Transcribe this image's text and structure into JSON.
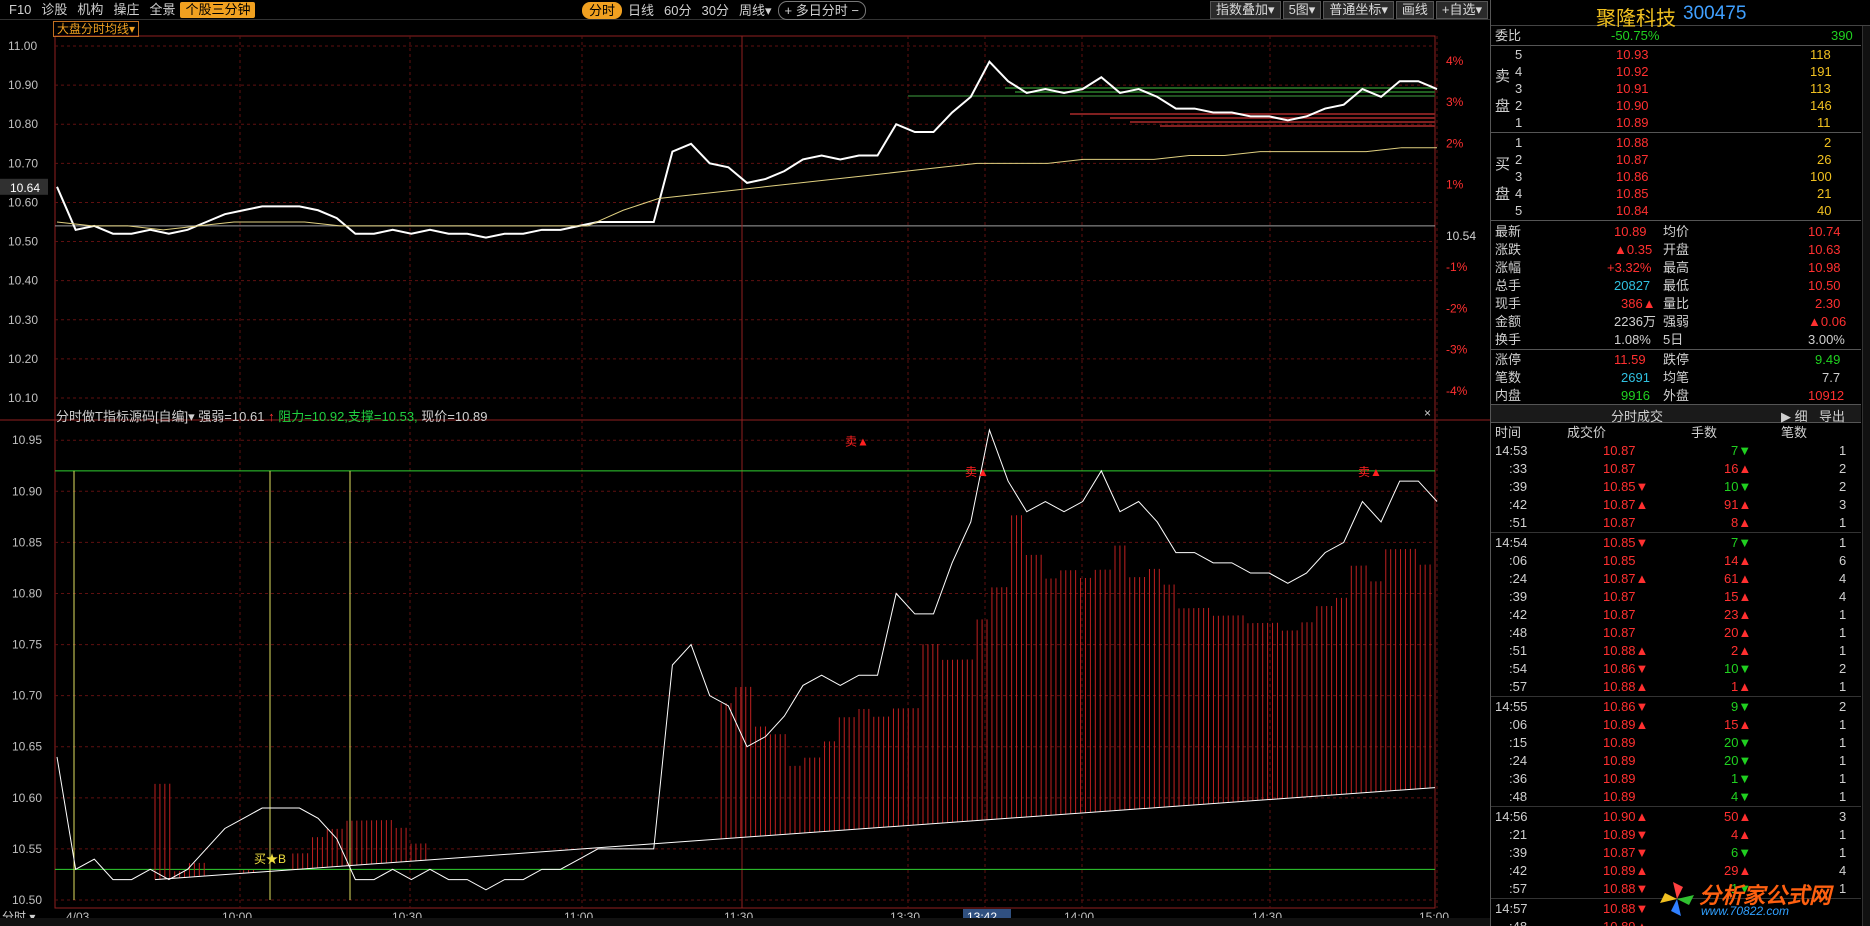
{
  "toolbar": {
    "left": [
      "F10",
      "诊股",
      "机构",
      "操庄",
      "全景",
      "个股三分钟"
    ],
    "left_active": 5,
    "center": [
      "分时",
      "日线",
      "60分",
      "30分",
      "周线▾",
      "+ 多日分时 −"
    ],
    "center_active": 0,
    "right": [
      "指数叠加▾",
      "5图▾",
      "普通坐标▾",
      "画线",
      "+自选▾"
    ]
  },
  "main_chart": {
    "indicator_tag": "大盘分时均线▾",
    "price_ticks": [
      "11.00",
      "10.90",
      "10.80",
      "10.70",
      "10.60",
      "10.50",
      "10.40",
      "10.30",
      "10.20",
      "10.10"
    ],
    "current_price_label": "10.64",
    "prev_close_label": "10.54",
    "pct_ticks": [
      "4%",
      "3%",
      "2%",
      "1%",
      "-1%",
      "-2%",
      "-3%",
      "-4%"
    ]
  },
  "sub_chart": {
    "title_a": "分时做T指标源码[自编]▾  强弱=10.61",
    "arrow": "↑",
    "title_b": "阻力=10.92,支撑=10.53,",
    "title_c": "现价=10.89",
    "close_icon": "×",
    "ticks": [
      "10.95",
      "10.90",
      "10.85",
      "10.80",
      "10.75",
      "10.70",
      "10.65",
      "10.60",
      "10.55",
      "10.50"
    ],
    "buy_label": "买★B",
    "sell_labels": [
      "卖▲",
      "卖▲",
      "卖▲"
    ]
  },
  "time_axis": {
    "labels": [
      "4/03",
      "10:00",
      "10:30",
      "11:00",
      "11:30",
      "13:30",
      "13:42",
      "14:00",
      "14:30",
      "15:00"
    ],
    "mode_label": "分时 ▾"
  },
  "quote": {
    "name": "聚隆科技",
    "code": "300475",
    "weibi_label": "委比",
    "weibi_value": "-50.75%",
    "weicha_value": "390",
    "sell_side_label": "卖盘",
    "buy_side_label": "买盘",
    "asks": [
      {
        "level": "5",
        "price": "10.93",
        "vol": "118"
      },
      {
        "level": "4",
        "price": "10.92",
        "vol": "191"
      },
      {
        "level": "3",
        "price": "10.91",
        "vol": "113"
      },
      {
        "level": "2",
        "price": "10.90",
        "vol": "146"
      },
      {
        "level": "1",
        "price": "10.89",
        "vol": "11"
      }
    ],
    "bids": [
      {
        "level": "1",
        "price": "10.88",
        "vol": "2"
      },
      {
        "level": "2",
        "price": "10.87",
        "vol": "26"
      },
      {
        "level": "3",
        "price": "10.86",
        "vol": "100"
      },
      {
        "level": "4",
        "price": "10.85",
        "vol": "21"
      },
      {
        "level": "5",
        "price": "10.84",
        "vol": "40"
      }
    ],
    "stats": [
      {
        "l1": "最新",
        "v1": "10.89",
        "c1": "red",
        "l2": "均价",
        "v2": "10.74",
        "c2": "red"
      },
      {
        "l1": "涨跌",
        "v1": "▲0.35",
        "c1": "red",
        "l2": "开盘",
        "v2": "10.63",
        "c2": "red"
      },
      {
        "l1": "涨幅",
        "v1": "+3.32%",
        "c1": "red",
        "l2": "最高",
        "v2": "10.98",
        "c2": "red"
      },
      {
        "l1": "总手",
        "v1": "20827",
        "c1": "cyn",
        "l2": "最低",
        "v2": "10.50",
        "c2": "red"
      },
      {
        "l1": "现手",
        "v1": "386▲",
        "c1": "red",
        "l2": "量比",
        "v2": "2.30",
        "c2": "red"
      },
      {
        "l1": "金额",
        "v1": "2236万",
        "c1": "wht",
        "l2": "强弱",
        "v2": "▲0.06",
        "c2": "red"
      },
      {
        "l1": "换手",
        "v1": "1.08%",
        "c1": "wht",
        "l2": "5日",
        "v2": "3.00%",
        "c2": "wht"
      },
      {
        "l1": "涨停",
        "v1": "11.59",
        "c1": "red",
        "l2": "跌停",
        "v2": "9.49",
        "c2": "grn"
      },
      {
        "l1": "笔数",
        "v1": "2691",
        "c1": "cyn",
        "l2": "均笔",
        "v2": "7.7",
        "c2": "wht"
      },
      {
        "l1": "内盘",
        "v1": "9916",
        "c1": "grn",
        "l2": "外盘",
        "v2": "10912",
        "c2": "red"
      }
    ]
  },
  "tape": {
    "title": "分时成交",
    "detail_label": "▶ 细",
    "export_label": "导出",
    "headers": [
      "时间",
      "成交价",
      "手数",
      "笔数"
    ],
    "rows": [
      {
        "t": "14:53",
        "p": "10.87",
        "pc": "red",
        "v": "7▼",
        "vc": "grn",
        "n": "1",
        "group": true
      },
      {
        "t": ":33",
        "p": "10.87",
        "pc": "red",
        "v": "16▲",
        "vc": "red",
        "n": "2"
      },
      {
        "t": ":39",
        "p": "10.85▼",
        "pc": "red",
        "v": "10▼",
        "vc": "grn",
        "n": "2"
      },
      {
        "t": ":42",
        "p": "10.87▲",
        "pc": "red",
        "v": "91▲",
        "vc": "red",
        "n": "3"
      },
      {
        "t": ":51",
        "p": "10.87",
        "pc": "red",
        "v": "8▲",
        "vc": "red",
        "n": "1"
      },
      {
        "t": "14:54",
        "p": "10.85▼",
        "pc": "red",
        "v": "7▼",
        "vc": "grn",
        "n": "1",
        "group": true
      },
      {
        "t": ":06",
        "p": "10.85",
        "pc": "red",
        "v": "14▲",
        "vc": "red",
        "n": "6"
      },
      {
        "t": ":24",
        "p": "10.87▲",
        "pc": "red",
        "v": "61▲",
        "vc": "red",
        "n": "4"
      },
      {
        "t": ":39",
        "p": "10.87",
        "pc": "red",
        "v": "15▲",
        "vc": "red",
        "n": "4"
      },
      {
        "t": ":42",
        "p": "10.87",
        "pc": "red",
        "v": "23▲",
        "vc": "red",
        "n": "1"
      },
      {
        "t": ":48",
        "p": "10.87",
        "pc": "red",
        "v": "20▲",
        "vc": "red",
        "n": "1"
      },
      {
        "t": ":51",
        "p": "10.88▲",
        "pc": "red",
        "v": "2▲",
        "vc": "red",
        "n": "1"
      },
      {
        "t": ":54",
        "p": "10.86▼",
        "pc": "red",
        "v": "10▼",
        "vc": "grn",
        "n": "2"
      },
      {
        "t": ":57",
        "p": "10.88▲",
        "pc": "red",
        "v": "1▲",
        "vc": "red",
        "n": "1"
      },
      {
        "t": "14:55",
        "p": "10.86▼",
        "pc": "red",
        "v": "9▼",
        "vc": "grn",
        "n": "2",
        "group": true
      },
      {
        "t": ":06",
        "p": "10.89▲",
        "pc": "red",
        "v": "15▲",
        "vc": "red",
        "n": "1"
      },
      {
        "t": ":15",
        "p": "10.89",
        "pc": "red",
        "v": "20▼",
        "vc": "grn",
        "n": "1"
      },
      {
        "t": ":24",
        "p": "10.89",
        "pc": "red",
        "v": "20▼",
        "vc": "grn",
        "n": "1"
      },
      {
        "t": ":36",
        "p": "10.89",
        "pc": "red",
        "v": "1▼",
        "vc": "grn",
        "n": "1"
      },
      {
        "t": ":48",
        "p": "10.89",
        "pc": "red",
        "v": "4▼",
        "vc": "grn",
        "n": "1"
      },
      {
        "t": "14:56",
        "p": "10.90▲",
        "pc": "red",
        "v": "50▲",
        "vc": "red",
        "n": "3",
        "group": true
      },
      {
        "t": ":21",
        "p": "10.89▼",
        "pc": "red",
        "v": "4▲",
        "vc": "red",
        "n": "1"
      },
      {
        "t": ":39",
        "p": "10.87▼",
        "pc": "red",
        "v": "6▼",
        "vc": "grn",
        "n": "1"
      },
      {
        "t": ":42",
        "p": "10.89▲",
        "pc": "red",
        "v": "29▲",
        "vc": "red",
        "n": "4"
      },
      {
        "t": ":57",
        "p": "10.88▼",
        "pc": "red",
        "v": "1▼",
        "vc": "grn",
        "n": "1"
      },
      {
        "t": "14:57",
        "p": "10.88▼",
        "pc": "red",
        "v": "",
        "vc": "grn",
        "n": "",
        "group": true
      },
      {
        "t": ":48",
        "p": "10.89▲",
        "pc": "red",
        "v": "",
        "vc": "red",
        "n": ""
      }
    ]
  },
  "watermark": {
    "text": "分析家公式网",
    "url": "www.70822.com"
  },
  "chart_data": {
    "type": "line",
    "x_range": [
      "09:30",
      "15:00"
    ],
    "price_ylim": [
      10.1,
      11.0
    ],
    "prev_close": 10.54,
    "price_series": [
      10.64,
      10.53,
      10.54,
      10.52,
      10.52,
      10.53,
      10.52,
      10.53,
      10.55,
      10.57,
      10.58,
      10.59,
      10.59,
      10.59,
      10.58,
      10.56,
      10.52,
      10.52,
      10.53,
      10.52,
      10.53,
      10.52,
      10.52,
      10.51,
      10.52,
      10.52,
      10.53,
      10.53,
      10.54,
      10.55,
      10.55,
      10.55,
      10.55,
      10.73,
      10.75,
      10.7,
      10.69,
      10.65,
      10.66,
      10.68,
      10.71,
      10.72,
      10.71,
      10.72,
      10.72,
      10.8,
      10.78,
      10.78,
      10.83,
      10.87,
      10.96,
      10.91,
      10.88,
      10.89,
      10.88,
      10.89,
      10.92,
      10.88,
      10.89,
      10.87,
      10.84,
      10.84,
      10.83,
      10.83,
      10.82,
      10.82,
      10.81,
      10.82,
      10.84,
      10.85,
      10.89,
      10.87,
      10.91,
      10.91,
      10.89
    ],
    "avg_series": [
      10.55,
      10.54,
      10.54,
      10.53,
      10.54,
      10.55,
      10.55,
      10.55,
      10.54,
      10.54,
      10.54,
      10.54,
      10.54,
      10.54,
      10.54,
      10.54,
      10.58,
      10.61,
      10.62,
      10.63,
      10.64,
      10.65,
      10.66,
      10.67,
      10.68,
      10.69,
      10.7,
      10.7,
      10.7,
      10.71,
      10.71,
      10.71,
      10.72,
      10.72,
      10.73,
      10.73,
      10.73,
      10.73,
      10.74,
      10.74
    ],
    "sub_ylim": [
      10.5,
      10.96
    ],
    "resistance": 10.92,
    "support": 10.53,
    "strength_line_start": 10.52,
    "strength_line_end": 10.61
  }
}
